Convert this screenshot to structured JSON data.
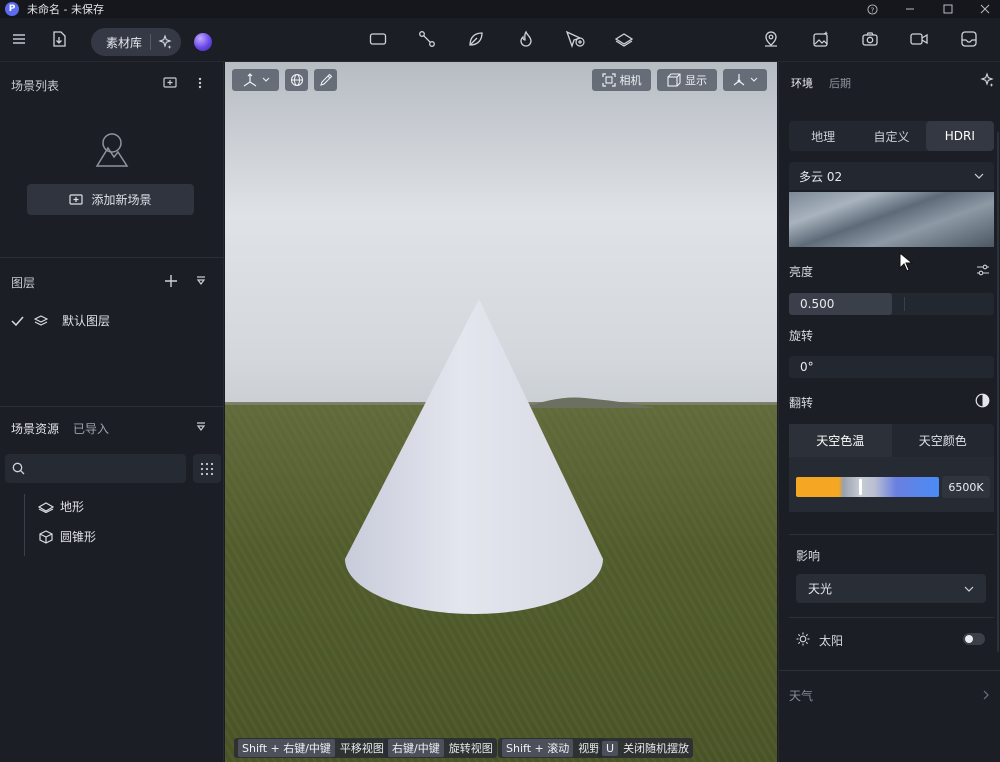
{
  "window": {
    "title": "未命名 - 未保存",
    "logo": "P"
  },
  "toolbar": {
    "assets_label": "素材库"
  },
  "left": {
    "scene_list_title": "场景列表",
    "add_scene_label": "添加新场景",
    "layers_title": "图层",
    "default_layer": "默认图层",
    "assets_title": "场景资源",
    "imported_tab": "已导入",
    "tree": [
      {
        "label": "地形",
        "icon": "terrain-icon"
      },
      {
        "label": "圆锥形",
        "icon": "cube-icon"
      }
    ]
  },
  "viewport": {
    "camera_label": "相机",
    "display_label": "显示",
    "hints": [
      {
        "key": "Shift + 右键/中键",
        "action": "平移视图"
      },
      {
        "key": "右键/中键",
        "action": "旋转视图"
      },
      {
        "key": "Shift + 滚动",
        "action": "视野"
      },
      {
        "key": "U",
        "action": "关闭随机摆放"
      }
    ]
  },
  "right": {
    "tabs": [
      "环境",
      "后期"
    ],
    "env_modes": [
      "地理",
      "自定义",
      "HDRI"
    ],
    "hdri_selected": "多云 02",
    "brightness_label": "亮度",
    "brightness_value": "0.500",
    "brightness_fraction": 0.5,
    "rotation_label": "旋转",
    "rotation_value": "0°",
    "flip_label": "翻转",
    "sky_tabs": [
      "天空色温",
      "天空颜色"
    ],
    "sky_temperature": "6500K",
    "influence_label": "影响",
    "influence_value": "天光",
    "sun_label": "太阳",
    "sun_enabled": false,
    "weather_label": "天气"
  }
}
